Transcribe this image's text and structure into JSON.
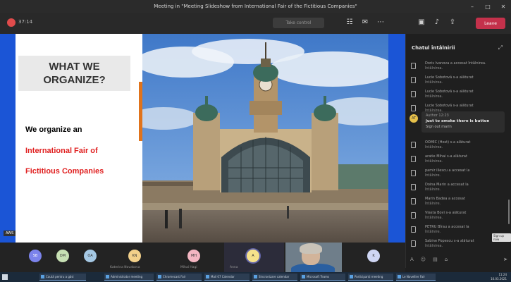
{
  "window": {
    "title": "Meeting in \"Meeting Slideshow from International Fair of the Fictitious Companies\"",
    "controls": [
      "–",
      "□",
      "✕"
    ]
  },
  "toolbar": {
    "app_label": "37:14",
    "center_pill": "Take control",
    "leave_label": "Leave",
    "icons": [
      "participants-icon",
      "chat-icon",
      "more-icon",
      "camera-icon",
      "mic-icon",
      "share-icon"
    ]
  },
  "slide": {
    "heading": "WHAT WE\nORGANIZE?",
    "line1": "We organize an",
    "line2": "International Fair of",
    "line3": "Fictitious Companies",
    "tag": "AWS"
  },
  "chat": {
    "title": "Chatul întâlnirii",
    "items": [
      {
        "l1": "Doris Ivanova a accesat întâlnirea.",
        "l2": "întâlnirea."
      },
      {
        "l1": "Lucie Sobotová s-a alăturat",
        "l2": "întâlnirea."
      },
      {
        "l1": "Lucie Sobotová s-a alăturat",
        "l2": "întâlnirea."
      },
      {
        "l1": "Lucie Sobotová s-a alăturat",
        "l2": "întâlnirea."
      },
      {
        "l1": "OOMIC (Host) s-a alăturat",
        "l2": "întâlnirea."
      },
      {
        "l1": "aratie Mihai s-a alăturat",
        "l2": "întâlnirea."
      },
      {
        "l1": "pamir iliescu a accesat la",
        "l2": "întâlnire."
      },
      {
        "l1": "Doina Marin a accesat la",
        "l2": "întâlnire."
      },
      {
        "l1": "Marin Badea a accesat",
        "l2": "întâlnire."
      },
      {
        "l1": "Vlasta Bovi s-a alăturat",
        "l2": "întâlnirea."
      },
      {
        "l1": "PETRU Bîrau a accesat la",
        "l2": "întâlnire."
      },
      {
        "l1": "Sabine Popescu s-a alăturat",
        "l2": "întâlnirea."
      }
    ],
    "bubble": {
      "author": "Author 12:23",
      "text": "just to smoke there is button",
      "sub": "Sign out marin"
    },
    "badge": "Sign up now",
    "compose_icons": [
      "format-icon",
      "emoji-icon",
      "gif-icon",
      "attach-icon",
      "send-icon"
    ]
  },
  "participants": [
    {
      "initials": "SB",
      "name": "",
      "color": "#7b83eb"
    },
    {
      "initials": "DM",
      "name": "",
      "color": "#c7e0b4"
    },
    {
      "initials": "OA",
      "name": "",
      "color": "#a5c8e4"
    },
    {
      "initials": "KN",
      "name": "Katerina Novakova",
      "color": "#f2d08a"
    },
    {
      "initials": "MH",
      "name": "Mihai Hagi",
      "color": "#f4b6c2"
    },
    {
      "initials": "A",
      "name": "Anna",
      "color": "#f6e28b"
    },
    {
      "initials": "K",
      "name": "",
      "color": "#cfd6f4"
    }
  ],
  "taskbar": {
    "items": [
      "Caută pentru a găsi",
      "Administrator meeting",
      "Chromecast Fair",
      "Mail 07 Calendar",
      "Sincronizare calendar",
      "Microsoft Teams",
      "Participanți meeting",
      "Le Novellier Fair"
    ],
    "clock_time": "11:24",
    "clock_date": "16.03.2021"
  }
}
